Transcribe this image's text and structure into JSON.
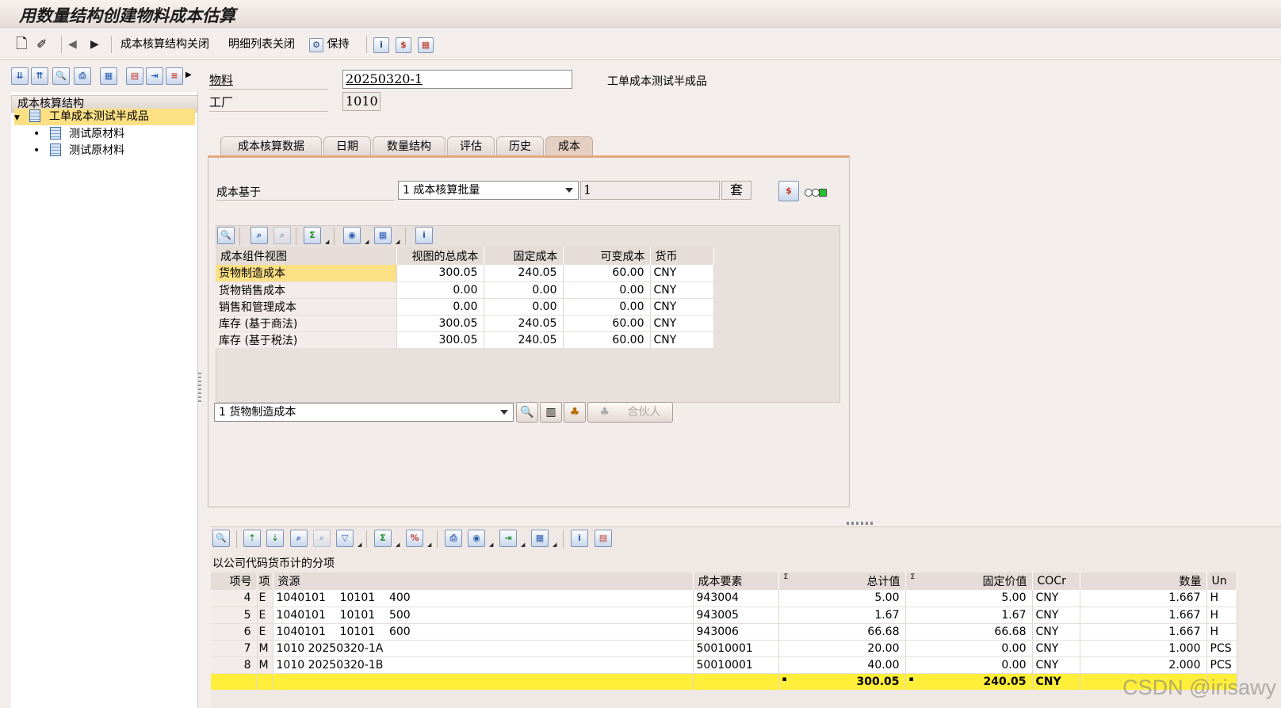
{
  "title": "用数量结构创建物料成本估算",
  "appbar": {
    "btn_close_structure": "成本核算结构关闭",
    "btn_close_detail": "明细列表关闭",
    "btn_keep": "保持"
  },
  "tree": {
    "header": "成本核算结构",
    "root": "工单成本测试半成品",
    "children": [
      "测试原材料",
      "测试原材料"
    ]
  },
  "header": {
    "material_label": "物料",
    "material_value": "20250320-1",
    "material_desc": "工单成本测试半成品",
    "plant_label": "工厂",
    "plant_value": "1010"
  },
  "tabs": [
    "成本核算数据",
    "日期",
    "数量结构",
    "评估",
    "历史",
    "成本"
  ],
  "cost_basis": {
    "label": "成本基于",
    "selected": "1 成本核算批量",
    "qty": "1",
    "unit": "套"
  },
  "component_grid": {
    "headers": [
      "成本组件视图",
      "视图的总成本",
      "固定成本",
      "可变成本",
      "货币"
    ],
    "rows": [
      [
        "货物制造成本",
        "300.05",
        "240.05",
        "60.00",
        "CNY"
      ],
      [
        "货物销售成本",
        "0.00",
        "0.00",
        "0.00",
        "CNY"
      ],
      [
        "销售和管理成本",
        "0.00",
        "0.00",
        "0.00",
        "CNY"
      ],
      [
        "库存 (基于商法)",
        "300.05",
        "240.05",
        "60.00",
        "CNY"
      ],
      [
        "库存 (基于税法)",
        "300.05",
        "240.05",
        "60.00",
        "CNY"
      ]
    ]
  },
  "view_select": {
    "selected": "1 货物制造成本",
    "partner_button": "合伙人"
  },
  "itemization": {
    "title": "以公司代码货币计的分项",
    "headers": [
      "项号",
      "项",
      "资源",
      "成本要素",
      "总计值",
      "固定价值",
      "COCr",
      "数量",
      "Un"
    ],
    "rows": [
      [
        "4",
        "E",
        "1040101    10101    400",
        "943004",
        "5.00",
        "5.00",
        "CNY",
        "1.667",
        "H"
      ],
      [
        "5",
        "E",
        "1040101    10101    500",
        "943005",
        "1.67",
        "1.67",
        "CNY",
        "1.667",
        "H"
      ],
      [
        "6",
        "E",
        "1040101    10101    600",
        "943006",
        "66.68",
        "66.68",
        "CNY",
        "1.667",
        "H"
      ],
      [
        "7",
        "M",
        "1010 20250320-1A",
        "50010001",
        "20.00",
        "0.00",
        "CNY",
        "1.000",
        "PCS"
      ],
      [
        "8",
        "M",
        "1010 20250320-1B",
        "50010001",
        "40.00",
        "0.00",
        "CNY",
        "2.000",
        "PCS"
      ]
    ],
    "total": {
      "mark": "▪",
      "total_value": "300.05",
      "fixed_value": "240.05",
      "currency": "CNY"
    },
    "sigma": "Σ"
  },
  "watermark": "CSDN @irisawy",
  "colors": {
    "selected_row": "#fbe084",
    "total_row": "#ffef3a",
    "active_tab": "#e5cfc3"
  }
}
